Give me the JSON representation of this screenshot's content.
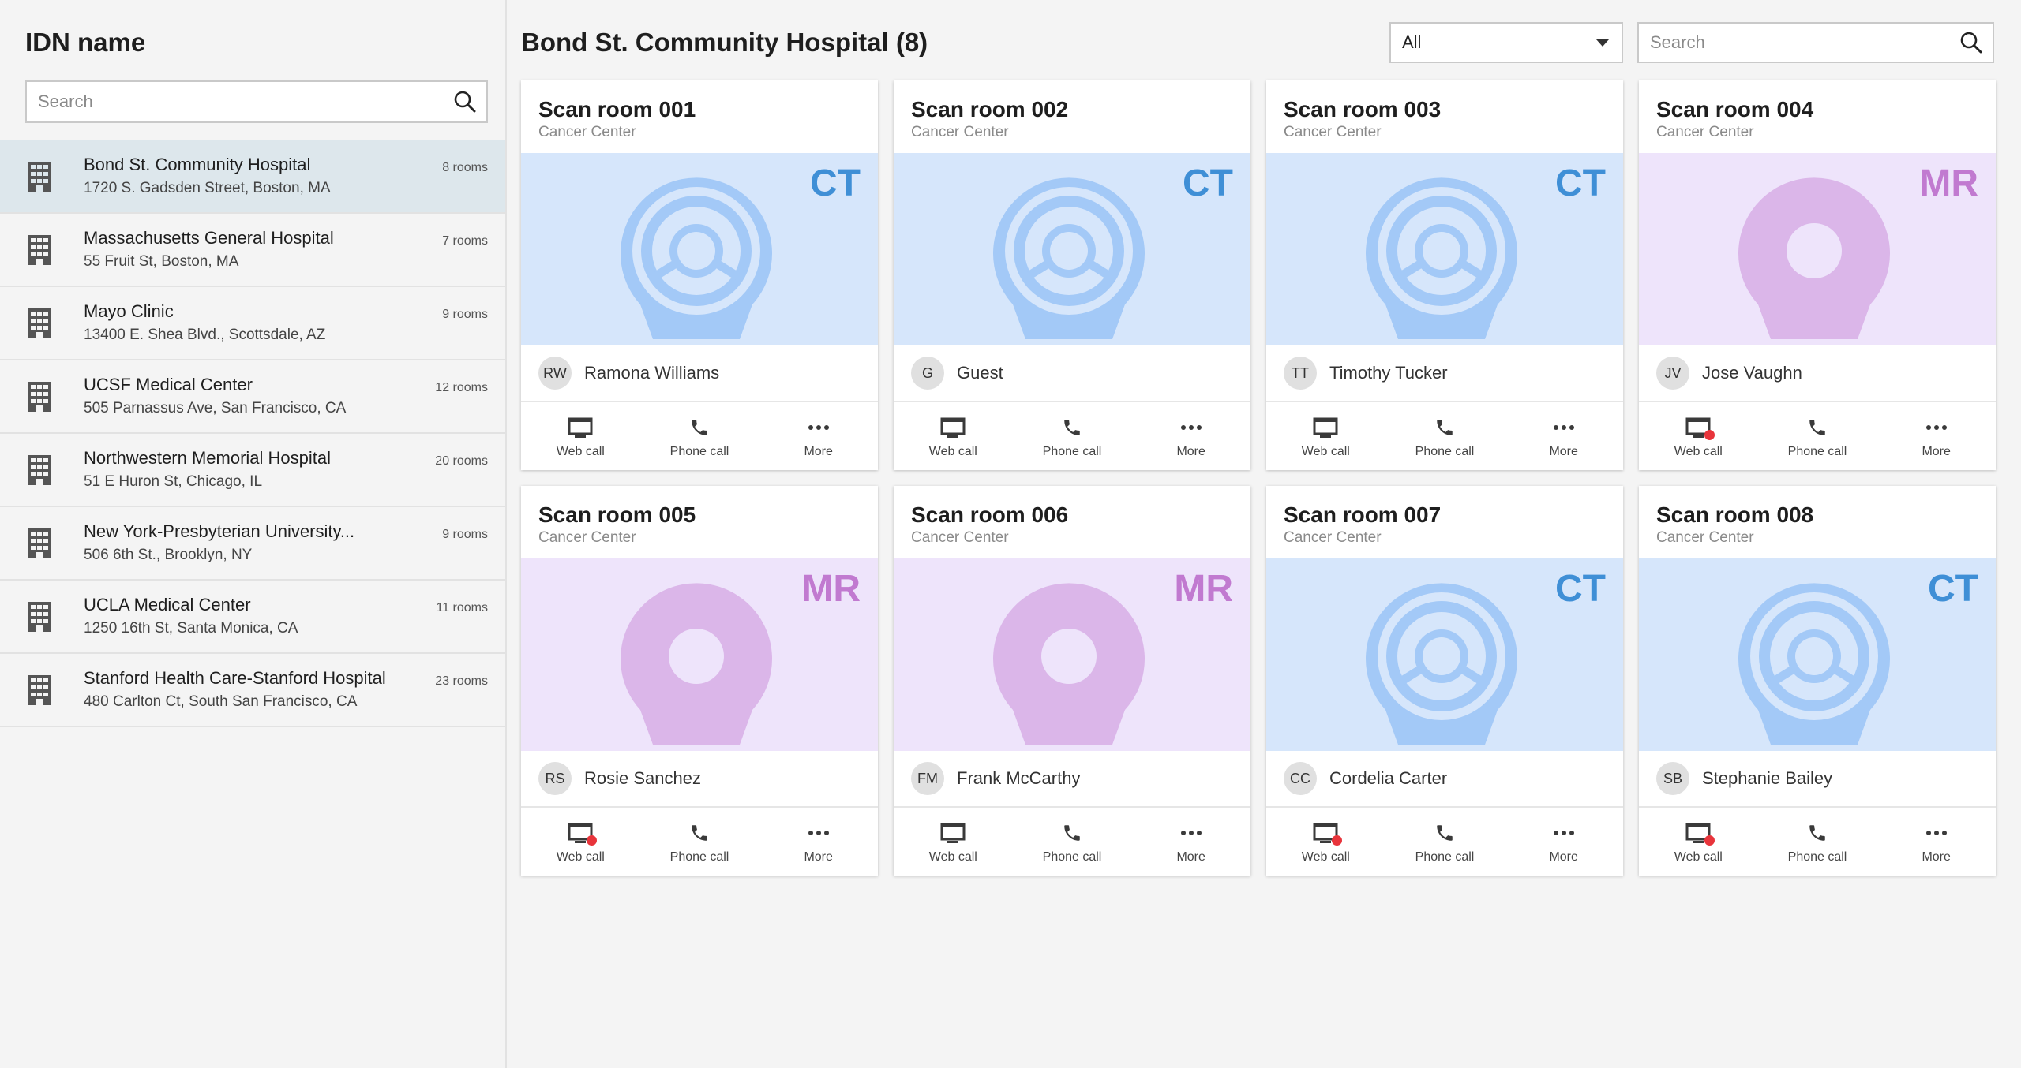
{
  "sidebar": {
    "title": "IDN name",
    "search_placeholder": "Search",
    "items": [
      {
        "name": "Bond St. Community Hospital",
        "address": "1720 S. Gadsden Street, Boston, MA",
        "rooms": "8 rooms",
        "selected": true
      },
      {
        "name": "Massachusetts General Hospital",
        "address": "55 Fruit St, Boston, MA",
        "rooms": "7 rooms",
        "selected": false
      },
      {
        "name": "Mayo Clinic",
        "address": "13400 E. Shea Blvd., Scottsdale, AZ",
        "rooms": "9 rooms",
        "selected": false
      },
      {
        "name": "UCSF Medical Center",
        "address": "505 Parnassus Ave, San Francisco, CA",
        "rooms": "12 rooms",
        "selected": false
      },
      {
        "name": "Northwestern Memorial Hospital",
        "address": "51 E Huron St, Chicago, IL",
        "rooms": "20 rooms",
        "selected": false
      },
      {
        "name": "New York-Presbyterian University...",
        "address": "506 6th St., Brooklyn, NY",
        "rooms": "9 rooms",
        "selected": false
      },
      {
        "name": "UCLA Medical Center",
        "address": "1250 16th St, Santa Monica, CA",
        "rooms": "11 rooms",
        "selected": false
      },
      {
        "name": "Stanford Health Care-Stanford Hospital",
        "address": "480 Carlton Ct, South San Francisco, CA",
        "rooms": "23 rooms",
        "selected": false
      }
    ],
    "item_icon": "building-icon"
  },
  "main": {
    "title": "Bond St. Community Hospital (8)",
    "filter": {
      "selected": "All"
    },
    "search_placeholder": "Search",
    "actions": {
      "web_call": "Web call",
      "phone_call": "Phone call",
      "more": "More"
    },
    "cards": [
      {
        "title": "Scan room 001",
        "subtitle": "Cancer Center",
        "modality": "CT",
        "initials": "RW",
        "user": "Ramona Williams",
        "web_call_notification": false
      },
      {
        "title": "Scan room 002",
        "subtitle": "Cancer Center",
        "modality": "CT",
        "initials": "G",
        "user": "Guest",
        "web_call_notification": false
      },
      {
        "title": "Scan room 003",
        "subtitle": "Cancer Center",
        "modality": "CT",
        "initials": "TT",
        "user": "Timothy Tucker",
        "web_call_notification": false
      },
      {
        "title": "Scan room 004",
        "subtitle": "Cancer Center",
        "modality": "MR",
        "initials": "JV",
        "user": "Jose Vaughn",
        "web_call_notification": true
      },
      {
        "title": "Scan room 005",
        "subtitle": "Cancer Center",
        "modality": "MR",
        "initials": "RS",
        "user": "Rosie Sanchez",
        "web_call_notification": true
      },
      {
        "title": "Scan room 006",
        "subtitle": "Cancer Center",
        "modality": "MR",
        "initials": "FM",
        "user": "Frank McCarthy",
        "web_call_notification": false
      },
      {
        "title": "Scan room 007",
        "subtitle": "Cancer Center",
        "modality": "CT",
        "initials": "CC",
        "user": "Cordelia Carter",
        "web_call_notification": true
      },
      {
        "title": "Scan room 008",
        "subtitle": "Cancer Center",
        "modality": "CT",
        "initials": "SB",
        "user": "Stephanie Bailey",
        "web_call_notification": true
      }
    ]
  },
  "colors": {
    "ct_background": "#d6e6fb",
    "ct_accent": "#3f8fd6",
    "ct_scanner": "#a3c9f7",
    "mr_background": "#eee4fb",
    "mr_accent": "#c17ad0",
    "mr_scanner": "#dbb6e9",
    "selected_item": "#dde7ec",
    "notification": "#e8343b"
  },
  "icons": {
    "search": "search-icon",
    "web_call": "monitor-icon",
    "phone_call": "phone-icon",
    "more": "more-dots-icon",
    "ct_scanner": "ct-scanner-icon",
    "mr_scanner": "mr-scanner-icon"
  }
}
